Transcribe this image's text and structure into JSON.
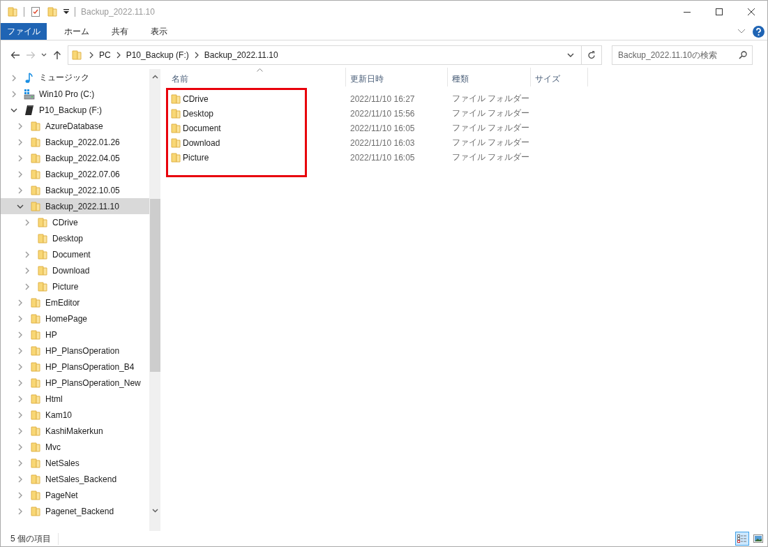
{
  "window": {
    "title": "Backup_2022.11.10"
  },
  "ribbon": {
    "tabs": [
      {
        "label": "ファイル",
        "kind": "file",
        "selected": false
      },
      {
        "label": "ホーム",
        "kind": "tab",
        "selected": false
      },
      {
        "label": "共有",
        "kind": "tab",
        "selected": false
      },
      {
        "label": "表示",
        "kind": "tab",
        "selected": false
      }
    ]
  },
  "address_bar": {
    "forward_disabled": true,
    "path": [
      "PC",
      "P10_Backup (F:)",
      "Backup_2022.11.10"
    ]
  },
  "search": {
    "placeholder": "Backup_2022.11.10の検索"
  },
  "nav_tree": {
    "items": [
      {
        "label": "ミュージック",
        "kind": "music",
        "expandable": true,
        "expanded": false,
        "selected": false
      },
      {
        "label": "Win10 Pro (C:)",
        "kind": "system-drive",
        "expandable": true,
        "expanded": false,
        "selected": false
      },
      {
        "label": "P10_Backup (F:)",
        "kind": "usb-drive",
        "expandable": true,
        "expanded": true,
        "selected": false,
        "children": [
          {
            "label": "AzureDatabase",
            "kind": "folder",
            "expandable": true,
            "expanded": false,
            "selected": false
          },
          {
            "label": "Backup_2022.01.26",
            "kind": "folder",
            "expandable": true,
            "expanded": false,
            "selected": false
          },
          {
            "label": "Backup_2022.04.05",
            "kind": "folder",
            "expandable": true,
            "expanded": false,
            "selected": false
          },
          {
            "label": "Backup_2022.07.06",
            "kind": "folder",
            "expandable": true,
            "expanded": false,
            "selected": false
          },
          {
            "label": "Backup_2022.10.05",
            "kind": "folder",
            "expandable": true,
            "expanded": false,
            "selected": false
          },
          {
            "label": "Backup_2022.11.10",
            "kind": "folder",
            "expandable": true,
            "expanded": true,
            "selected": true,
            "children": [
              {
                "label": "CDrive",
                "kind": "folder",
                "expandable": true,
                "expanded": false,
                "selected": false
              },
              {
                "label": "Desktop",
                "kind": "folder",
                "expandable": false,
                "selected": false
              },
              {
                "label": "Document",
                "kind": "folder",
                "expandable": true,
                "expanded": false,
                "selected": false
              },
              {
                "label": "Download",
                "kind": "folder",
                "expandable": true,
                "expanded": false,
                "selected": false
              },
              {
                "label": "Picture",
                "kind": "folder",
                "expandable": true,
                "expanded": false,
                "selected": false
              }
            ]
          },
          {
            "label": "EmEditor",
            "kind": "folder",
            "expandable": true,
            "expanded": false,
            "selected": false
          },
          {
            "label": "HomePage",
            "kind": "folder",
            "expandable": true,
            "expanded": false,
            "selected": false
          },
          {
            "label": "HP",
            "kind": "folder",
            "expandable": true,
            "expanded": false,
            "selected": false
          },
          {
            "label": "HP_PlansOperation",
            "kind": "folder",
            "expandable": true,
            "expanded": false,
            "selected": false
          },
          {
            "label": "HP_PlansOperation_B4",
            "kind": "folder",
            "expandable": true,
            "expanded": false,
            "selected": false
          },
          {
            "label": "HP_PlansOperation_New",
            "kind": "folder",
            "expandable": true,
            "expanded": false,
            "selected": false
          },
          {
            "label": "Html",
            "kind": "folder",
            "expandable": true,
            "expanded": false,
            "selected": false
          },
          {
            "label": "Kam10",
            "kind": "folder",
            "expandable": true,
            "expanded": false,
            "selected": false
          },
          {
            "label": "KashiMakerkun",
            "kind": "folder",
            "expandable": true,
            "expanded": false,
            "selected": false
          },
          {
            "label": "Mvc",
            "kind": "folder",
            "expandable": true,
            "expanded": false,
            "selected": false
          },
          {
            "label": "NetSales",
            "kind": "folder",
            "expandable": true,
            "expanded": false,
            "selected": false
          },
          {
            "label": "NetSales_Backend",
            "kind": "folder",
            "expandable": true,
            "expanded": false,
            "selected": false
          },
          {
            "label": "PageNet",
            "kind": "folder",
            "expandable": true,
            "expanded": false,
            "selected": false
          },
          {
            "label": "Pagenet_Backend",
            "kind": "folder",
            "expandable": true,
            "expanded": false,
            "selected": false
          }
        ]
      }
    ]
  },
  "file_list": {
    "columns": [
      {
        "label": "名前",
        "sorted": true
      },
      {
        "label": "更新日時",
        "sorted": false
      },
      {
        "label": "種類",
        "sorted": false
      },
      {
        "label": "サイズ",
        "sorted": false
      }
    ],
    "highlighted": true,
    "rows": [
      {
        "name": "CDrive",
        "modified": "2022/11/10 16:27",
        "type": "ファイル フォルダー",
        "selected": false
      },
      {
        "name": "Desktop",
        "modified": "2022/11/10 15:56",
        "type": "ファイル フォルダー",
        "selected": false
      },
      {
        "name": "Document",
        "modified": "2022/11/10 16:05",
        "type": "ファイル フォルダー",
        "selected": false
      },
      {
        "name": "Download",
        "modified": "2022/11/10 16:03",
        "type": "ファイル フォルダー",
        "selected": false
      },
      {
        "name": "Picture",
        "modified": "2022/11/10 16:05",
        "type": "ファイル フォルダー",
        "selected": false
      }
    ]
  },
  "status_bar": {
    "item_count": "5 個の項目",
    "views": [
      {
        "kind": "details",
        "selected": true
      },
      {
        "kind": "large-icons",
        "selected": false
      }
    ]
  }
}
